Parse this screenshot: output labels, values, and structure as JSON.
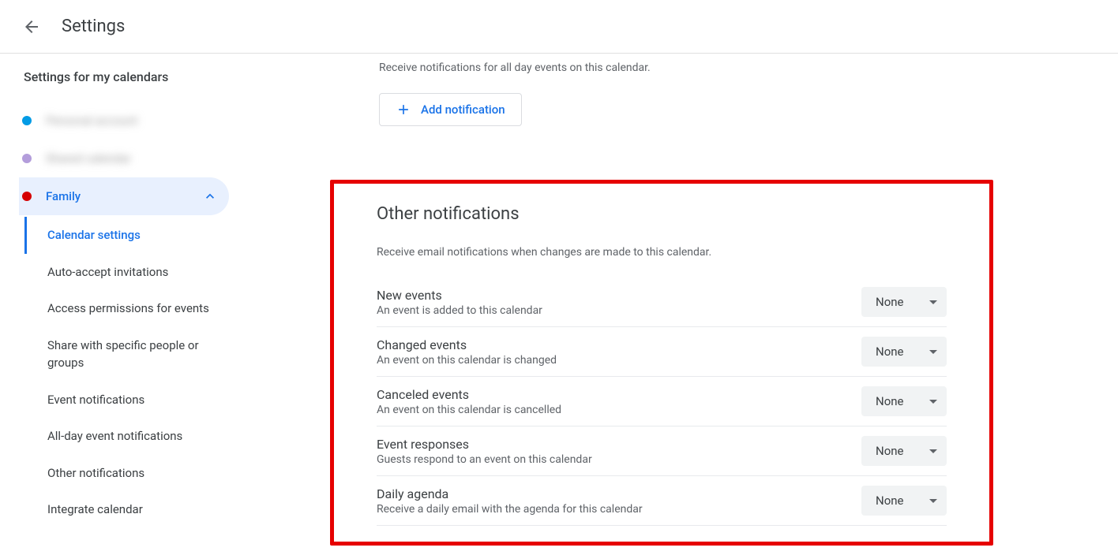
{
  "header": {
    "title": "Settings"
  },
  "sidebar": {
    "heading": "Settings for my calendars",
    "calendars": [
      {
        "color": "#039be5",
        "label": "Personal account",
        "blurred": true,
        "selected": false
      },
      {
        "color": "#b39ddb",
        "label": "Shared calendar",
        "blurred": true,
        "selected": false
      },
      {
        "color": "#d50000",
        "label": "Family",
        "blurred": false,
        "selected": true
      }
    ],
    "subnav": [
      {
        "label": "Calendar settings",
        "active": true
      },
      {
        "label": "Auto-accept invitations",
        "active": false
      },
      {
        "label": "Access permissions for events",
        "active": false
      },
      {
        "label": "Share with specific people or groups",
        "active": false
      },
      {
        "label": "Event notifications",
        "active": false
      },
      {
        "label": "All-day event notifications",
        "active": false
      },
      {
        "label": "Other notifications",
        "active": false
      },
      {
        "label": "Integrate calendar",
        "active": false
      }
    ]
  },
  "main": {
    "allday_desc": "Receive notifications for all day events on this calendar.",
    "add_notification": "Add notification",
    "other_notifications": {
      "title": "Other notifications",
      "desc": "Receive email notifications when changes are made to this calendar.",
      "rows": [
        {
          "title": "New events",
          "sub": "An event is added to this calendar",
          "value": "None"
        },
        {
          "title": "Changed events",
          "sub": "An event on this calendar is changed",
          "value": "None"
        },
        {
          "title": "Canceled events",
          "sub": "An event on this calendar is cancelled",
          "value": "None"
        },
        {
          "title": "Event responses",
          "sub": "Guests respond to an event on this calendar",
          "value": "None"
        },
        {
          "title": "Daily agenda",
          "sub": "Receive a daily email with the agenda for this calendar",
          "value": "None"
        }
      ]
    }
  }
}
